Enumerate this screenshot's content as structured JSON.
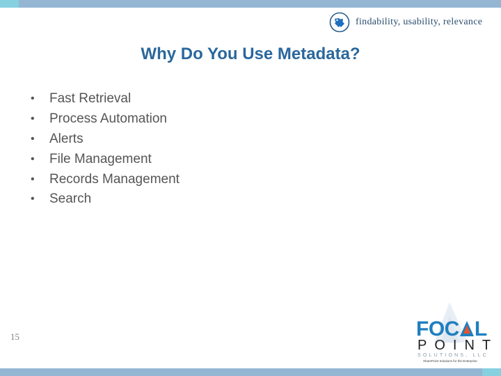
{
  "header": {
    "icon": "tag-icon",
    "tagline": "findability, usability, relevance"
  },
  "slide": {
    "title": "Why Do You Use Metadata?",
    "bullets": [
      "Fast Retrieval",
      "Process Automation",
      "Alerts",
      "File Management",
      "Records Management",
      "Search"
    ],
    "bullet_glyph": "•",
    "number": "15"
  },
  "logo": {
    "line1_prefix": "FOC",
    "line1_suffix": "L",
    "line2": "POINT",
    "line3": "SOLUTIONS, LLC",
    "tagline": "SharePoint Solutions for the Enterprise"
  },
  "colors": {
    "title": "#2a679c",
    "bar": "#94b6d2",
    "bar_accent": "#86d0e0",
    "logo_blue": "#1f7fc0",
    "logo_orange": "#e8532a"
  }
}
